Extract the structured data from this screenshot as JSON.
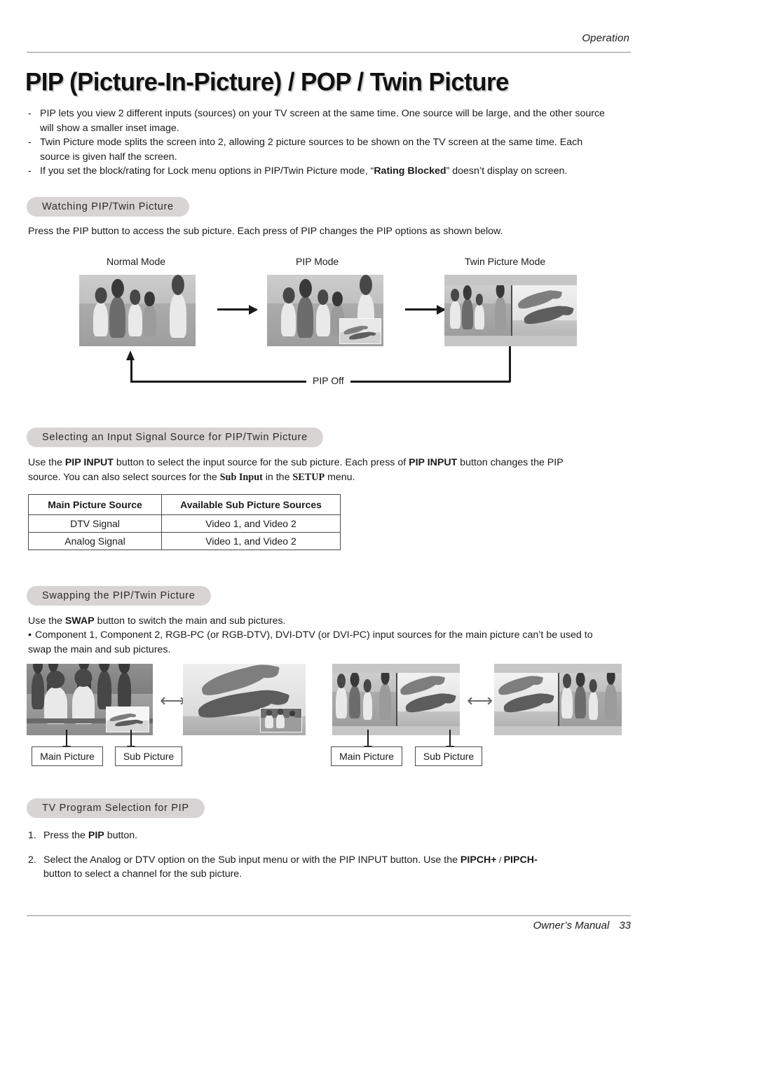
{
  "header": {
    "section_label": "Operation"
  },
  "title": "PIP (Picture-In-Picture) / POP / Twin Picture",
  "intro": {
    "bullet_marker": "-",
    "items": [
      "PIP lets you view 2 different inputs (sources) on your TV screen at the same time. One source will be large, and the other source will show a smaller inset image.",
      "Twin Picture mode splits the screen into 2, allowing 2 picture sources to be shown on the TV screen at the same time. Each source is given half the screen.",
      "If you set the block/rating for Lock menu options in PIP/Twin Picture mode, “Rating Blocked” doesn’t display on screen."
    ],
    "bold_terms": [
      "Rating Blocked"
    ]
  },
  "section_watching": {
    "heading": "Watching PIP/Twin Picture",
    "paragraph": "Press the PIP button to access the sub picture. Each press of PIP changes the PIP options as shown below.",
    "mode_labels": [
      "Normal Mode",
      "PIP Mode",
      "Twin Picture Mode"
    ],
    "loop_label": "PIP Off",
    "arrow_glyph": "→"
  },
  "section_input": {
    "heading": "Selecting an Input Signal Source for PIP/Twin Picture",
    "paragraph_parts": {
      "p1": "Use the ",
      "b1": "PIP INPUT",
      "p2": " button to select the input source for the sub picture. Each press of ",
      "b2": "PIP INPUT",
      "p3": " button changes the PIP source. You can also select sources for the ",
      "b3": "Sub Input",
      "p4": " in the ",
      "b4": "SETUP",
      "p5": " menu."
    },
    "table": {
      "columns": [
        "Main Picture Source",
        "Available Sub Picture Sources"
      ],
      "rows": [
        [
          "DTV Signal",
          "Video 1, and Video 2"
        ],
        [
          "Analog Signal",
          "Video 1, and Video 2"
        ]
      ]
    }
  },
  "section_swapping": {
    "heading": "Swapping the PIP/Twin Picture",
    "line1_parts": {
      "p1": "Use the ",
      "b1": "SWAP",
      "p2": " button to switch the main and sub pictures."
    },
    "bullet_marker": "•",
    "line2": "Component 1, Component 2, RGB-PC (or RGB-DTV), DVI-DTV (or DVI-PC) input sources for the main picture can’t be used to swap the main and sub pictures.",
    "labels": {
      "main_picture": "Main Picture",
      "sub_picture": "Sub Picture"
    },
    "swap_glyph": "⬌"
  },
  "section_tvprogram": {
    "heading": "TV Program Selection for PIP",
    "steps": [
      {
        "num": "1.",
        "p1": "Press the ",
        "b1": "PIP",
        "p2": " button."
      },
      {
        "num": "2.",
        "p1": "Select the Analog or DTV option on the Sub input menu or with the PIP INPUT button. Use the ",
        "b1": "PIPCH+",
        "p2": " / ",
        "b2": "PIPCH-",
        "p3": " button to select a channel for the sub picture."
      }
    ]
  },
  "footer": {
    "manual_label": "Owner’s Manual",
    "page_number": "33"
  },
  "colors": {
    "pill_background": "#d9d4d4",
    "rule": "#8d8d8d",
    "text": "#1a1a1a",
    "photo_base": "#b9b9b9",
    "arrow": "#1a1a1a",
    "swap_arrow": "#6b6b6b"
  }
}
